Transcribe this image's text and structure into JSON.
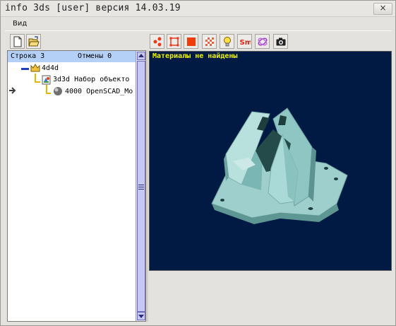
{
  "window": {
    "title": "info 3ds [user] версия 14.03.19",
    "close_glyph": "×"
  },
  "menu": {
    "items": [
      "Вид"
    ]
  },
  "toolbar_left": [
    {
      "name": "new-file-button",
      "icon": "new-document-icon"
    },
    {
      "name": "open-file-button",
      "icon": "open-folder-icon"
    }
  ],
  "toolbar_right": [
    {
      "name": "points-button",
      "icon": "points-icon"
    },
    {
      "name": "wireframe-button",
      "icon": "wireframe-icon"
    },
    {
      "name": "solid-button",
      "icon": "solid-fill-icon"
    },
    {
      "name": "texture-button",
      "icon": "checker-icon"
    },
    {
      "name": "lighting-button",
      "icon": "lightbulb-icon"
    },
    {
      "name": "smooth-button",
      "icon": "smoothing-icon",
      "label": "Sm"
    },
    {
      "name": "orbit-button",
      "icon": "orbit-icon"
    },
    {
      "name": "screenshot-button",
      "icon": "camera-icon"
    }
  ],
  "left_panel": {
    "row_label": "Строка 3",
    "undo_label": "Отмены 0",
    "tree": [
      {
        "id": "4d4d",
        "label": "4d4d",
        "icon": "crown-icon",
        "level": 0
      },
      {
        "id": "3d3d",
        "label": "3d3d Набор объекто",
        "icon": "object-set-icon",
        "level": 1
      },
      {
        "id": "4000",
        "label": "4000 OpenSCAD_Mo",
        "icon": "sphere-icon",
        "level": 2,
        "current": true
      }
    ]
  },
  "viewport": {
    "message": "Материалы не найдены"
  },
  "colors": {
    "viewport_bg": "#001a44",
    "message": "#f0f000",
    "header_bg": "#b4d0f7",
    "model": "#9fd4d0"
  }
}
